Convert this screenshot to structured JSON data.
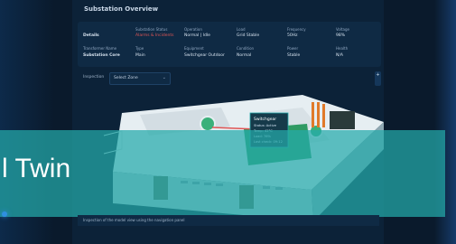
{
  "page": {
    "title": "Substation Overview"
  },
  "summary": {
    "row1": [
      {
        "label": "",
        "value": "Details",
        "alert": false
      },
      {
        "label": "Substation Status",
        "value": "Alarms & Incidents",
        "alert": true
      },
      {
        "label": "Operation",
        "value": "Normal | Idle",
        "alert": false
      },
      {
        "label": "Load",
        "value": "Grid Stable",
        "alert": false
      },
      {
        "label": "Frequency",
        "value": "50Hz",
        "alert": false
      },
      {
        "label": "Voltage",
        "value": "98%",
        "alert": false
      }
    ],
    "row2": [
      {
        "label": "Transformer Name",
        "value": "Substation Core",
        "alert": false
      },
      {
        "label": "Type",
        "value": "Main",
        "alert": false
      },
      {
        "label": "Equipment",
        "value": "Switchgear Outdoor",
        "alert": false
      },
      {
        "label": "Condition",
        "value": "Normal",
        "alert": false
      },
      {
        "label": "Power",
        "value": "Stable",
        "alert": false
      },
      {
        "label": "Health",
        "value": "N/A",
        "alert": false
      }
    ]
  },
  "selector": {
    "label": "Inspection",
    "value": "Select Zone",
    "chevron_icon": "chevron-down-icon"
  },
  "zoom": {
    "label": "+"
  },
  "popup": {
    "title": "Switchgear",
    "lines": [
      "Status: Active",
      "Temp: 42°C",
      "Load: 76%",
      "Last check: 09:12"
    ]
  },
  "banner": {
    "text": "l Twin"
  },
  "footer": {
    "text": "Inspection of the model view using the navigation panel"
  },
  "colors": {
    "accent": "#24aaaa",
    "alert": "#e05555",
    "panel": "#0c2238"
  }
}
